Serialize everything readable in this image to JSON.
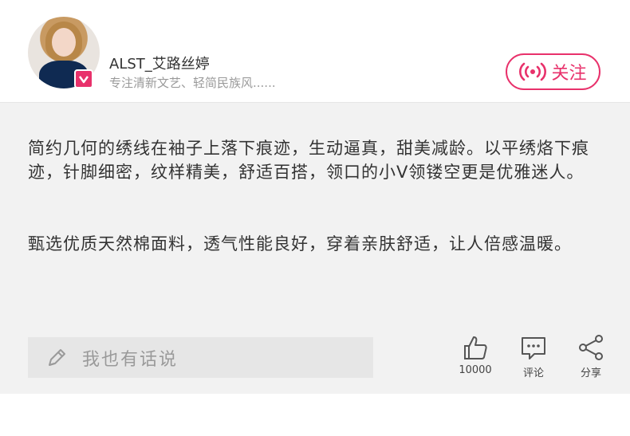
{
  "author": {
    "name": "ALST_艾路丝婷",
    "description": "专注清新文艺、轻简民族风......"
  },
  "follow": {
    "label": "关注"
  },
  "article": {
    "paragraph1": "简约几何的绣线在袖子上落下痕迹，生动逼真，甜美减龄。以平绣烙下痕迹，针脚细密，纹样精美，舒适百搭，领口的小V领镂空更是优雅迷人。",
    "paragraph2": "甄选优质天然棉面料，透气性能良好，穿着亲肤舒适，让人倍感温暖。"
  },
  "comment_input": {
    "placeholder": "我也有话说"
  },
  "actions": {
    "like_count": "10000",
    "comment_label": "评论",
    "share_label": "分享"
  },
  "colors": {
    "accent": "#e8316b",
    "content_bg": "#f2f2f2"
  },
  "icons": [
    "pencil-icon",
    "thumbs-up-icon",
    "comment-icon",
    "share-icon",
    "broadcast-icon",
    "v-badge-icon"
  ]
}
